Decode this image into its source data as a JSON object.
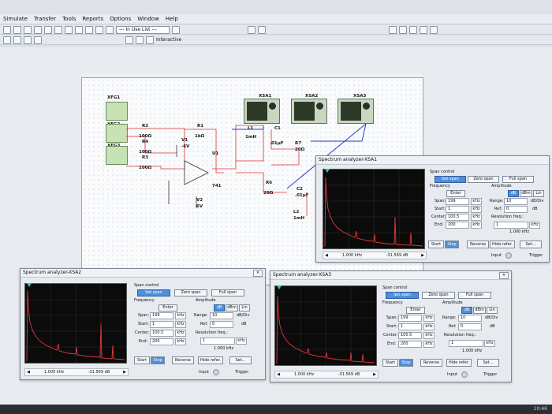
{
  "menu": [
    "Simulate",
    "Transfer",
    "Tools",
    "Reports",
    "Options",
    "Window",
    "Help"
  ],
  "toolbar": {
    "in_use_list": "--- In Use List ---",
    "interactive": "Interactive"
  },
  "schematic": {
    "instruments": [
      "XFG1",
      "XFG2",
      "XFG3",
      "XSA1",
      "XSA2",
      "XSA3"
    ],
    "parts": [
      {
        "ref": "R2",
        "value": "100Ω"
      },
      {
        "ref": "R4",
        "value": "100Ω"
      },
      {
        "ref": "R3",
        "value": "100Ω"
      },
      {
        "ref": "R1",
        "value": "1kΩ"
      },
      {
        "ref": "V1",
        "value": "-6V"
      },
      {
        "ref": "U1",
        "value": "741"
      },
      {
        "ref": "V2",
        "value": "6V"
      },
      {
        "ref": "L1",
        "value": "1mH"
      },
      {
        "ref": "C1",
        "value": ".01µF"
      },
      {
        "ref": "R7",
        "value": "20Ω"
      },
      {
        "ref": "R6",
        "value": "20Ω"
      },
      {
        "ref": "C2",
        "value": ".01µF"
      },
      {
        "ref": "L2",
        "value": "1mH"
      }
    ]
  },
  "analyzers": [
    {
      "title": "Spectrum analyzer-XSA1",
      "span_control": "Span control",
      "set_span": "Set span",
      "zero_span": "Zero span",
      "full_span": "Full span",
      "frequency": "Frequency",
      "amplitude": "Amplitude",
      "enter": "Enter",
      "db": "dB",
      "dbm": "dBm",
      "lin": "Lin",
      "span_label": "Span:",
      "span_value": "199",
      "span_unit": "kHz",
      "start_label": "Start:",
      "start_value": "1",
      "start_unit": "kHz",
      "center_label": "Center:",
      "center_value": "100.5",
      "center_unit": "kHz",
      "end_label": "End:",
      "end_value": "200",
      "end_unit": "kHz",
      "range_label": "Range:",
      "range_value": "10",
      "range_unit": "dB/Div",
      "ref_label": "Ref:",
      "ref_value": "0",
      "ref_unit": "dB",
      "resolution_label": "Resolution freq.:",
      "resolution_value": "1",
      "resolution_unit": "kHz",
      "resolution_readout": "1.000 kHz",
      "readout_freq": "1.000 kHz",
      "readout_db": "-31.569 dB",
      "start_btn": "Start",
      "stop_btn": "Stop",
      "reverse_btn": "Reverse",
      "hide_ref_btn": "Hide refer.",
      "set_btn": "Set...",
      "input": "Input",
      "trigger": "Trigger"
    },
    {
      "title": "Spectrum analyzer-XSA2",
      "span_control": "Span control",
      "set_span": "Set span",
      "zero_span": "Zero span",
      "full_span": "Full span",
      "frequency": "Frequency",
      "amplitude": "Amplitude",
      "enter": "Enter",
      "db": "dB",
      "dbm": "dBm",
      "lin": "Lin",
      "span_label": "Span:",
      "span_value": "199",
      "span_unit": "kHz",
      "start_label": "Start:",
      "start_value": "1",
      "start_unit": "kHz",
      "center_label": "Center:",
      "center_value": "100.5",
      "center_unit": "kHz",
      "end_label": "End:",
      "end_value": "200",
      "end_unit": "kHz",
      "range_label": "Range:",
      "range_value": "10",
      "range_unit": "dB/Div",
      "ref_label": "Ref:",
      "ref_value": "0",
      "ref_unit": "dB",
      "resolution_label": "Resolution freq.:",
      "resolution_value": "1",
      "resolution_unit": "kHz",
      "resolution_readout": "1.000 kHz",
      "readout_freq": "1.000 kHz",
      "readout_db": "-31.569 dB",
      "start_btn": "Start",
      "stop_btn": "Stop",
      "reverse_btn": "Reverse",
      "hide_ref_btn": "Hide refer.",
      "set_btn": "Set...",
      "input": "Input",
      "trigger": "Trigger"
    },
    {
      "title": "Spectrum analyzer-XSA3",
      "span_control": "Span control",
      "set_span": "Set span",
      "zero_span": "Zero span",
      "full_span": "Full span",
      "frequency": "Frequency",
      "amplitude": "Amplitude",
      "enter": "Enter",
      "db": "dB",
      "dbm": "dBm",
      "lin": "Lin",
      "span_label": "Span:",
      "span_value": "199",
      "span_unit": "kHz",
      "start_label": "Start:",
      "start_value": "1",
      "start_unit": "kHz",
      "center_label": "Center:",
      "center_value": "100.5",
      "center_unit": "kHz",
      "end_label": "End:",
      "end_value": "200",
      "end_unit": "kHz",
      "range_label": "Range:",
      "range_value": "10",
      "range_unit": "dB/Div",
      "ref_label": "Ref:",
      "ref_value": "0",
      "ref_unit": "dB",
      "resolution_label": "Resolution freq.:",
      "resolution_value": "1",
      "resolution_unit": "kHz",
      "resolution_readout": "1.000 kHz",
      "readout_freq": "1.000 kHz",
      "readout_db": "-31.569 dB",
      "start_btn": "Start",
      "stop_btn": "Stop",
      "reverse_btn": "Reverse",
      "hide_ref_btn": "Hide refer.",
      "set_btn": "Set...",
      "input": "Input",
      "trigger": "Trigger"
    }
  ],
  "taskbar": {
    "clock": "10:46"
  },
  "colors": {
    "trace": "#e23a3a",
    "grid": "#3a3a3a",
    "active_button": "#4f8edc"
  }
}
